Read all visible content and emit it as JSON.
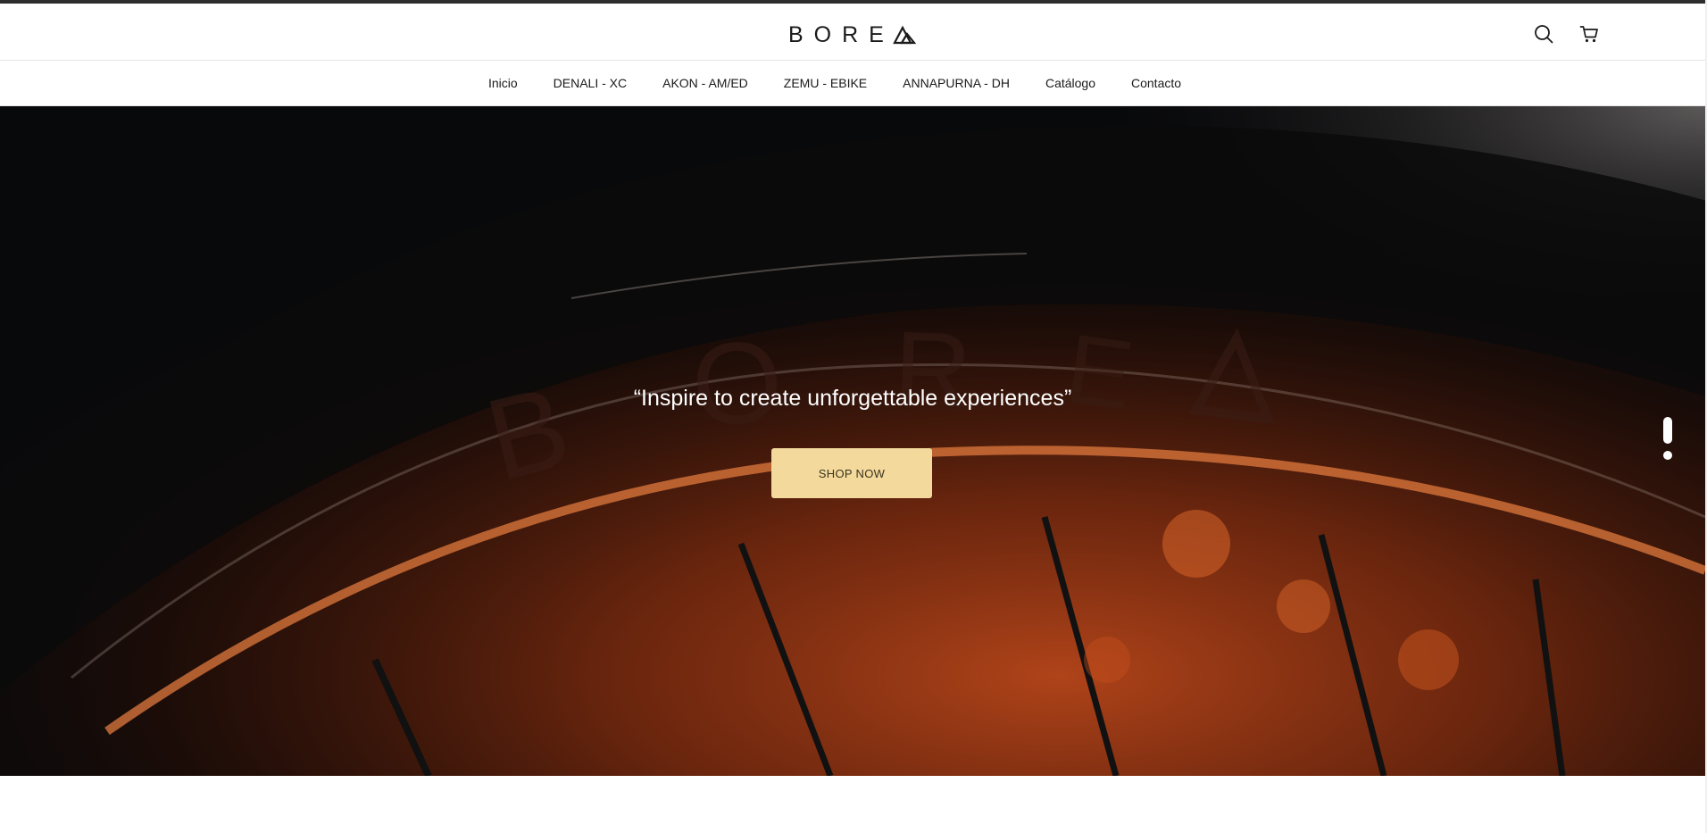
{
  "header": {
    "logo_text": "BORE",
    "icons": [
      "search-icon",
      "cart-icon"
    ]
  },
  "nav": {
    "items": [
      {
        "label": "Inicio"
      },
      {
        "label": "DENALI - XC"
      },
      {
        "label": "AKON - AM/ED"
      },
      {
        "label": "ZEMU - EBIKE"
      },
      {
        "label": "ANNAPURNA - DH"
      },
      {
        "label": "Catálogo"
      },
      {
        "label": "Contacto"
      }
    ]
  },
  "hero": {
    "quote": "“Inspire to create unforgettable experiences”",
    "button_label": "SHOP NOW",
    "slides_total": 2,
    "active_slide": 1
  },
  "colors": {
    "button_bg": "#f3d99b",
    "text_dark": "#1a1a1a",
    "hero_dark": "#08090b",
    "hero_accent": "#c4501c"
  }
}
